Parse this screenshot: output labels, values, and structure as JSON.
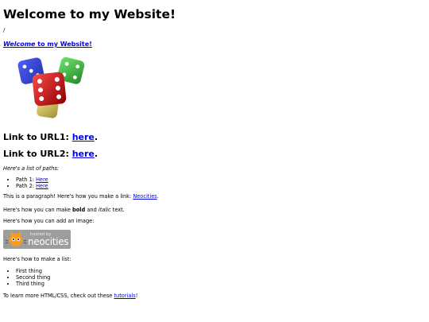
{
  "page": {
    "title": "Welcome to my Website!",
    "slash": "/",
    "site_link": {
      "italic": "Welcome",
      "rest": " to my Website!"
    },
    "url1": {
      "label": "Link to URL1: ",
      "link": "here",
      "end": "."
    },
    "url2": {
      "label": "Link to URL2: ",
      "link": "here",
      "end": "."
    },
    "paths_title": "Here's a list of paths:",
    "paths": [
      {
        "label": "Path 1: ",
        "link": "Here"
      },
      {
        "label": "Path 2: ",
        "link": "Here"
      }
    ],
    "paragraph_link": {
      "text": "This is a paragraph! Here's how you make a link: ",
      "link": "Neocities",
      "end": "."
    },
    "format": {
      "pre": "Here's how you can make ",
      "bold": "bold",
      "mid": " and ",
      "italic": "italic",
      "post": " text."
    },
    "image_text": "Here's how you can add an image:",
    "badge": {
      "small": "hosted by",
      "name": "neocities"
    },
    "list_text": "Here's how to make a list:",
    "list": [
      "First thing",
      "Second thing",
      "Third thing"
    ],
    "learn": {
      "pre": "To learn more HTML/CSS, check out these ",
      "link": "tutorials",
      "end": "!"
    }
  },
  "colors": {
    "link": "#0000ee",
    "badge_bg": "#9d9d9d"
  },
  "icons": [
    "dice-image",
    "neocities-cat-icon"
  ]
}
